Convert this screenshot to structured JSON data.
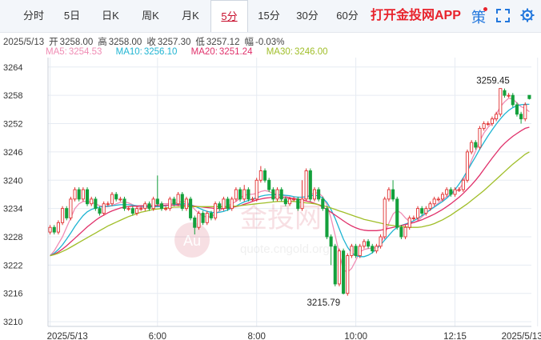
{
  "tabs": [
    {
      "label": "分时"
    },
    {
      "label": "5日"
    },
    {
      "label": "日K"
    },
    {
      "label": "周K"
    },
    {
      "label": "月K"
    },
    {
      "label": "5分"
    },
    {
      "label": "15分"
    },
    {
      "label": "30分"
    },
    {
      "label": "60分"
    }
  ],
  "active_tab": "5分",
  "app_link": "打开金投网APP",
  "policy_icon_text": "策",
  "info": {
    "date": "2025/5/13",
    "open_label": "开",
    "open": "3258.00",
    "high_label": "高",
    "high": "3258.00",
    "close_label": "收",
    "close": "3257.30",
    "low_label": "低",
    "low": "3257.12",
    "change_label": "幅",
    "change": "-0.03%"
  },
  "ma": [
    {
      "label": "MA5:",
      "value": "3254.53",
      "color": "#f08cb4"
    },
    {
      "label": "MA10:",
      "value": "3256.10",
      "color": "#1eb4d2"
    },
    {
      "label": "MA20:",
      "value": "3251.24",
      "color": "#e0306a"
    },
    {
      "label": "MA30:",
      "value": "3246.00",
      "color": "#a0be28"
    }
  ],
  "watermark": {
    "logo": "Au",
    "text": "金投网",
    "url": "quote.cngold.org"
  },
  "colors": {
    "up": "#e03030",
    "down": "#14a03c",
    "grid": "#e6ebf2",
    "axis_text": "#333333"
  },
  "chart_data": {
    "type": "candlestick",
    "y_ticks": [
      3210,
      3216,
      3222,
      3228,
      3234,
      3240,
      3246,
      3252,
      3258,
      3264
    ],
    "ylim": [
      3209,
      3266
    ],
    "x_labels": [
      "2025/5/13",
      "6:00",
      "8:00",
      "10:00",
      "12:15",
      "2025/5/13"
    ],
    "x_label_index": [
      0,
      26,
      50,
      74,
      98,
      118
    ],
    "annotations": [
      {
        "text": "3259.45",
        "index": 112,
        "value": 3259.45,
        "type": "high"
      },
      {
        "text": "3215.79",
        "index": 71,
        "value": 3215.79,
        "type": "low"
      }
    ],
    "candles": [
      [
        3229.0,
        3230.0,
        3228.5,
        3230.5
      ],
      [
        3230.0,
        3229.0,
        3228.5,
        3230.5
      ],
      [
        3229.0,
        3231.0,
        3228.5,
        3231.5
      ],
      [
        3231.0,
        3234.0,
        3230.5,
        3234.5
      ],
      [
        3234.0,
        3232.0,
        3231.5,
        3234.5
      ],
      [
        3232.0,
        3236.0,
        3231.5,
        3236.5
      ],
      [
        3236.0,
        3238.0,
        3235.5,
        3238.5
      ],
      [
        3238.0,
        3236.0,
        3235.5,
        3238.5
      ],
      [
        3236.0,
        3238.0,
        3235.5,
        3238.5
      ],
      [
        3238.0,
        3235.0,
        3234.5,
        3238.5
      ],
      [
        3235.0,
        3236.0,
        3234.5,
        3236.5
      ],
      [
        3236.0,
        3234.0,
        3233.5,
        3236.5
      ],
      [
        3234.0,
        3233.0,
        3232.5,
        3234.5
      ],
      [
        3233.0,
        3235.0,
        3232.5,
        3235.5
      ],
      [
        3235.0,
        3235.0,
        3234.5,
        3235.5
      ],
      [
        3235.0,
        3237.0,
        3234.5,
        3237.5
      ],
      [
        3237.0,
        3236.0,
        3235.5,
        3237.5
      ],
      [
        3236.0,
        3236.0,
        3235.5,
        3236.5
      ],
      [
        3236.0,
        3234.0,
        3233.5,
        3236.5
      ],
      [
        3234.0,
        3234.0,
        3233.5,
        3234.5
      ],
      [
        3234.0,
        3233.0,
        3232.5,
        3234.5
      ],
      [
        3233.0,
        3234.0,
        3232.5,
        3234.5
      ],
      [
        3234.0,
        3234.0,
        3233.5,
        3234.5
      ],
      [
        3234.0,
        3235.0,
        3233.5,
        3235.5
      ],
      [
        3235.0,
        3234.0,
        3233.5,
        3235.5
      ],
      [
        3234.0,
        3236.0,
        3233.5,
        3236.5
      ],
      [
        3236.0,
        3235.0,
        3234.5,
        3241.0
      ],
      [
        3235.0,
        3234.0,
        3233.5,
        3235.5
      ],
      [
        3234.0,
        3234.0,
        3233.5,
        3234.5
      ],
      [
        3234.0,
        3236.0,
        3233.5,
        3236.5
      ],
      [
        3236.0,
        3235.0,
        3234.5,
        3236.5
      ],
      [
        3235.0,
        3237.0,
        3234.5,
        3237.5
      ],
      [
        3237.0,
        3234.0,
        3233.5,
        3237.5
      ],
      [
        3234.0,
        3236.0,
        3233.5,
        3236.5
      ],
      [
        3236.0,
        3232.0,
        3231.5,
        3236.5
      ],
      [
        3232.0,
        3230.0,
        3228.5,
        3232.5
      ],
      [
        3230.0,
        3233.0,
        3229.5,
        3233.5
      ],
      [
        3233.0,
        3231.0,
        3230.5,
        3233.5
      ],
      [
        3231.0,
        3233.0,
        3230.5,
        3233.5
      ],
      [
        3233.0,
        3232.0,
        3231.5,
        3233.5
      ],
      [
        3232.0,
        3235.0,
        3231.5,
        3235.5
      ],
      [
        3235.0,
        3234.0,
        3233.5,
        3235.5
      ],
      [
        3234.0,
        3236.0,
        3233.5,
        3236.5
      ],
      [
        3236.0,
        3234.0,
        3233.5,
        3236.5
      ],
      [
        3234.0,
        3236.0,
        3233.5,
        3236.5
      ],
      [
        3236.0,
        3238.0,
        3235.5,
        3238.5
      ],
      [
        3238.0,
        3236.0,
        3235.5,
        3238.5
      ],
      [
        3236.0,
        3238.0,
        3235.5,
        3239.0
      ],
      [
        3238.0,
        3236.0,
        3235.5,
        3238.5
      ],
      [
        3236.0,
        3236.0,
        3235.5,
        3236.5
      ],
      [
        3236.0,
        3240.0,
        3235.5,
        3240.5
      ],
      [
        3240.0,
        3242.0,
        3239.5,
        3243.0
      ],
      [
        3242.0,
        3240.0,
        3239.5,
        3242.5
      ],
      [
        3240.0,
        3238.0,
        3237.5,
        3240.5
      ],
      [
        3238.0,
        3236.0,
        3235.5,
        3238.5
      ],
      [
        3236.0,
        3238.0,
        3235.5,
        3238.5
      ],
      [
        3238.0,
        3236.0,
        3235.5,
        3238.5
      ],
      [
        3236.0,
        3235.0,
        3234.5,
        3236.5
      ],
      [
        3235.0,
        3236.0,
        3234.5,
        3236.5
      ],
      [
        3236.0,
        3236.0,
        3235.5,
        3236.5
      ],
      [
        3236.0,
        3234.0,
        3233.5,
        3236.5
      ],
      [
        3234.0,
        3236.0,
        3233.5,
        3240.0
      ],
      [
        3236.0,
        3242.0,
        3235.5,
        3242.5
      ],
      [
        3242.0,
        3236.0,
        3235.5,
        3242.5
      ],
      [
        3236.0,
        3238.0,
        3235.5,
        3238.5
      ],
      [
        3238.0,
        3236.0,
        3235.5,
        3238.5
      ],
      [
        3236.0,
        3234.0,
        3233.5,
        3236.5
      ],
      [
        3234.0,
        3228.0,
        3227.5,
        3234.5
      ],
      [
        3228.0,
        3226.0,
        3222.0,
        3228.5
      ],
      [
        3226.0,
        3218.0,
        3217.5,
        3226.5
      ],
      [
        3218.0,
        3225.0,
        3217.5,
        3225.5
      ],
      [
        3225.0,
        3216.0,
        3215.79,
        3225.5
      ],
      [
        3216.0,
        3224.0,
        3215.5,
        3224.5
      ],
      [
        3224.0,
        3226.0,
        3223.5,
        3226.5
      ],
      [
        3226.0,
        3224.0,
        3223.5,
        3226.5
      ],
      [
        3224.0,
        3226.0,
        3223.5,
        3226.5
      ],
      [
        3226.0,
        3227.0,
        3225.5,
        3227.5
      ],
      [
        3227.0,
        3226.0,
        3225.5,
        3227.5
      ],
      [
        3226.0,
        3225.0,
        3224.5,
        3226.5
      ],
      [
        3225.0,
        3226.0,
        3224.5,
        3226.5
      ],
      [
        3226.0,
        3228.0,
        3225.5,
        3228.5
      ],
      [
        3228.0,
        3236.0,
        3227.5,
        3236.5
      ],
      [
        3236.0,
        3238.0,
        3235.5,
        3238.5
      ],
      [
        3238.0,
        3236.0,
        3235.5,
        3240.0
      ],
      [
        3236.0,
        3230.0,
        3229.5,
        3236.5
      ],
      [
        3230.0,
        3228.0,
        3227.5,
        3230.5
      ],
      [
        3228.0,
        3230.0,
        3227.5,
        3230.5
      ],
      [
        3230.0,
        3232.0,
        3229.5,
        3232.5
      ],
      [
        3232.0,
        3232.0,
        3231.5,
        3232.5
      ],
      [
        3232.0,
        3234.0,
        3231.5,
        3234.5
      ],
      [
        3234.0,
        3233.0,
        3232.5,
        3234.5
      ],
      [
        3233.0,
        3234.0,
        3232.5,
        3234.5
      ],
      [
        3234.0,
        3235.0,
        3233.5,
        3235.5
      ],
      [
        3235.0,
        3236.0,
        3234.5,
        3236.5
      ],
      [
        3236.0,
        3236.0,
        3235.5,
        3236.5
      ],
      [
        3236.0,
        3237.0,
        3235.5,
        3237.5
      ],
      [
        3237.0,
        3238.0,
        3236.5,
        3238.5
      ],
      [
        3238.0,
        3237.0,
        3236.5,
        3238.5
      ],
      [
        3237.0,
        3238.0,
        3236.5,
        3238.5
      ],
      [
        3238.0,
        3238.0,
        3237.5,
        3238.5
      ],
      [
        3238.0,
        3240.0,
        3237.5,
        3240.5
      ],
      [
        3240.0,
        3246.0,
        3239.5,
        3246.5
      ],
      [
        3246.0,
        3248.0,
        3245.5,
        3248.5
      ],
      [
        3248.0,
        3247.0,
        3246.5,
        3248.5
      ],
      [
        3247.0,
        3251.0,
        3246.5,
        3251.5
      ],
      [
        3251.0,
        3252.0,
        3250.5,
        3252.5
      ],
      [
        3252.0,
        3252.0,
        3251.5,
        3252.5
      ],
      [
        3252.0,
        3253.0,
        3251.5,
        3253.5
      ],
      [
        3253.0,
        3254.0,
        3252.5,
        3254.5
      ],
      [
        3254.0,
        3259.45,
        3253.5,
        3259.45
      ],
      [
        3259.0,
        3258.0,
        3257.5,
        3259.45
      ],
      [
        3258.0,
        3258.0,
        3257.5,
        3258.5
      ],
      [
        3258.0,
        3256.0,
        3255.5,
        3258.5
      ],
      [
        3256.0,
        3254.0,
        3253.5,
        3256.5
      ],
      [
        3254.0,
        3253.0,
        3252.0,
        3254.5
      ],
      [
        3253.0,
        3256.0,
        3252.5,
        3256.5
      ],
      [
        3258.0,
        3257.3,
        3257.12,
        3258.0
      ]
    ],
    "ma_lines": {
      "ma5": [
        3224,
        3225,
        3226.5,
        3228,
        3230,
        3232,
        3234,
        3235,
        3235.5,
        3235.5,
        3235.3,
        3235,
        3234.6,
        3234.4,
        3234.4,
        3234.6,
        3235,
        3235.3,
        3235.4,
        3235.2,
        3234.8,
        3234.4,
        3234.2,
        3234.2,
        3234.3,
        3234.5,
        3234.8,
        3235,
        3235,
        3235,
        3235,
        3235.3,
        3235.5,
        3235.4,
        3234.8,
        3233.8,
        3233,
        3232.4,
        3232.2,
        3232.3,
        3232.8,
        3233.5,
        3234.1,
        3234.6,
        3235,
        3235.5,
        3236.2,
        3236.8,
        3237,
        3237,
        3237.2,
        3237.6,
        3237.8,
        3237.6,
        3237.2,
        3236.9,
        3236.8,
        3236.6,
        3236.3,
        3236.1,
        3235.9,
        3235.8,
        3236.3,
        3236.9,
        3237.3,
        3237.3,
        3236.5,
        3234.8,
        3232,
        3228.3,
        3224.5,
        3221,
        3220.5,
        3221.3,
        3223,
        3224.8,
        3225.3,
        3225.5,
        3225.6,
        3225.7,
        3226.5,
        3228.5,
        3230.9,
        3232.8,
        3233.6,
        3233,
        3232,
        3231.2,
        3231,
        3231.4,
        3232.2,
        3233,
        3233.8,
        3234.4,
        3235.2,
        3235.9,
        3236.5,
        3237,
        3237.5,
        3238.1,
        3239.4,
        3241.8,
        3244.2,
        3246.2,
        3248.3,
        3250,
        3251.2,
        3252.1,
        3254,
        3255.6,
        3256.6,
        3257.4,
        3257.2,
        3256.4,
        3255.6,
        3255.2,
        3254.53
      ],
      "ma10": [
        3224,
        3224.5,
        3225.3,
        3226.3,
        3227.5,
        3228.8,
        3230.2,
        3231.4,
        3232.5,
        3233.3,
        3233.8,
        3234.1,
        3234.3,
        3234.4,
        3234.5,
        3234.6,
        3234.7,
        3234.8,
        3234.8,
        3234.8,
        3234.7,
        3234.6,
        3234.5,
        3234.4,
        3234.4,
        3234.4,
        3234.4,
        3234.5,
        3234.6,
        3234.7,
        3234.8,
        3234.9,
        3235,
        3235,
        3234.8,
        3234.5,
        3234.1,
        3233.7,
        3233.4,
        3233.2,
        3233.1,
        3233.2,
        3233.4,
        3233.7,
        3234.1,
        3234.5,
        3235,
        3235.4,
        3235.7,
        3236,
        3236.3,
        3236.6,
        3236.8,
        3236.9,
        3236.9,
        3236.9,
        3236.9,
        3236.8,
        3236.7,
        3236.5,
        3236.4,
        3236.4,
        3236.5,
        3236.7,
        3236.8,
        3236.7,
        3236.2,
        3235.3,
        3233.8,
        3231.9,
        3229.7,
        3227.5,
        3225.8,
        3224.6,
        3224,
        3223.8,
        3223.8,
        3224.1,
        3224.6,
        3225.4,
        3226.3,
        3227.3,
        3228.3,
        3229.3,
        3230,
        3230.4,
        3230.7,
        3231,
        3231.4,
        3231.9,
        3232.5,
        3233.1,
        3233.7,
        3234.3,
        3234.9,
        3235.5,
        3236.2,
        3237,
        3238,
        3239.2,
        3240.5,
        3242,
        3243.5,
        3245,
        3246.6,
        3248,
        3249.4,
        3250.7,
        3251.9,
        3253,
        3254,
        3254.8,
        3255.4,
        3255.8,
        3256,
        3256.1,
        3256.1
      ],
      "ma20": [
        3224,
        3224.3,
        3224.8,
        3225.4,
        3226.1,
        3226.9,
        3227.7,
        3228.5,
        3229.3,
        3230.1,
        3230.8,
        3231.5,
        3232.1,
        3232.6,
        3233.1,
        3233.5,
        3233.8,
        3234.1,
        3234.3,
        3234.4,
        3234.5,
        3234.5,
        3234.6,
        3234.6,
        3234.6,
        3234.6,
        3234.6,
        3234.6,
        3234.7,
        3234.7,
        3234.7,
        3234.7,
        3234.7,
        3234.7,
        3234.6,
        3234.5,
        3234.4,
        3234.3,
        3234.2,
        3234.1,
        3234,
        3234,
        3234,
        3234.1,
        3234.2,
        3234.4,
        3234.6,
        3234.9,
        3235.2,
        3235.5,
        3235.8,
        3236,
        3236.2,
        3236.3,
        3236.4,
        3236.4,
        3236.4,
        3236.3,
        3236.2,
        3236.1,
        3236,
        3235.8,
        3235.6,
        3235.4,
        3235.1,
        3234.8,
        3234.3,
        3233.8,
        3233.2,
        3232.6,
        3232,
        3231.4,
        3230.8,
        3230.3,
        3229.9,
        3229.6,
        3229.4,
        3229.3,
        3229.3,
        3229.3,
        3229.4,
        3229.6,
        3229.8,
        3230,
        3230.2,
        3230.4,
        3230.6,
        3230.8,
        3231,
        3231.3,
        3231.6,
        3232,
        3232.4,
        3232.8,
        3233.3,
        3233.8,
        3234.4,
        3235,
        3235.7,
        3236.4,
        3237.2,
        3238.1,
        3239,
        3240,
        3241.1,
        3242.3,
        3243.5,
        3244.7,
        3245.8,
        3246.9,
        3247.8,
        3248.6,
        3249.3,
        3249.9,
        3250.5,
        3251,
        3251.24
      ],
      "ma30": [
        3224,
        3224.2,
        3224.5,
        3224.9,
        3225.3,
        3225.8,
        3226.3,
        3226.8,
        3227.3,
        3227.8,
        3228.3,
        3228.8,
        3229.3,
        3229.8,
        3230.3,
        3230.7,
        3231.1,
        3231.5,
        3231.9,
        3232.3,
        3232.6,
        3232.9,
        3233.2,
        3233.4,
        3233.6,
        3233.8,
        3233.9,
        3234,
        3234.1,
        3234.2,
        3234.3,
        3234.3,
        3234.4,
        3234.4,
        3234.4,
        3234.4,
        3234.4,
        3234.4,
        3234.4,
        3234.4,
        3234.4,
        3234.4,
        3234.4,
        3234.4,
        3234.5,
        3234.5,
        3234.6,
        3234.7,
        3234.8,
        3234.9,
        3235,
        3235.1,
        3235.2,
        3235.3,
        3235.4,
        3235.5,
        3235.5,
        3235.5,
        3235.5,
        3235.5,
        3235.4,
        3235.3,
        3235.2,
        3235.1,
        3235,
        3234.8,
        3234.6,
        3234.4,
        3234.1,
        3233.8,
        3233.5,
        3233.2,
        3232.9,
        3232.6,
        3232.3,
        3232,
        3231.7,
        3231.5,
        3231.3,
        3231.1,
        3230.9,
        3230.7,
        3230.5,
        3230.4,
        3230.3,
        3230.2,
        3230.1,
        3230,
        3230,
        3230,
        3230.1,
        3230.3,
        3230.5,
        3230.8,
        3231.2,
        3231.6,
        3232.1,
        3232.6,
        3233.2,
        3233.8,
        3234.4,
        3235,
        3235.7,
        3236.4,
        3237.1,
        3237.8,
        3238.6,
        3239.4,
        3240.2,
        3241,
        3241.8,
        3242.6,
        3243.4,
        3244.1,
        3244.8,
        3245.5,
        3246
      ]
    }
  }
}
